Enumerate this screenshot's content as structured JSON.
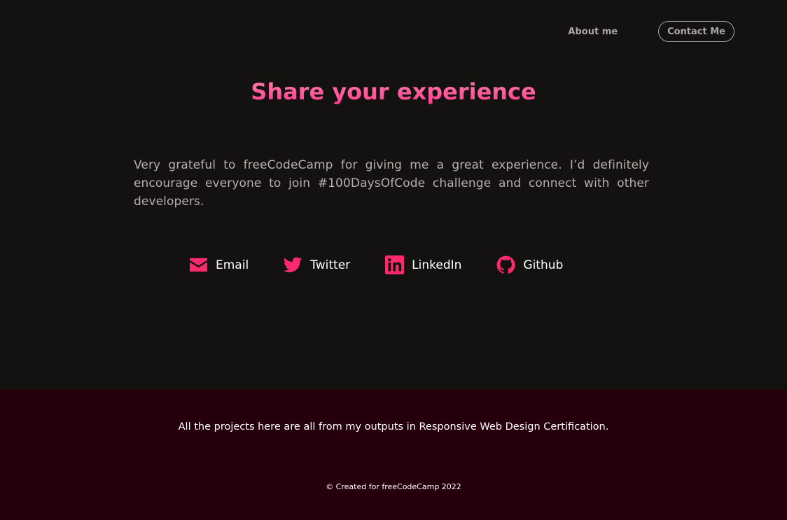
{
  "nav": {
    "about_label": "About me",
    "contact_label": "Contact Me"
  },
  "main": {
    "title": "Share your experience",
    "paragraph": "Very grateful to freeCodeCamp for giving me a great experience. I’d definitely encourage everyone to join #100DaysOfCode challenge and connect with other developers.",
    "socials": [
      {
        "label": "Email",
        "icon": "envelope-icon"
      },
      {
        "label": "Twitter",
        "icon": "twitter-icon"
      },
      {
        "label": "LinkedIn",
        "icon": "linkedin-icon"
      },
      {
        "label": "Github",
        "icon": "github-icon"
      }
    ]
  },
  "footer": {
    "text": "All the projects here are all from my outputs in Responsive Web Design Certification.",
    "copyright": "© Created for freeCodeCamp 2022"
  },
  "colors": {
    "background": "#141111",
    "accent": "#ff2a6d",
    "footer_bg": "#25000c",
    "muted_text": "#b4b0b0"
  }
}
